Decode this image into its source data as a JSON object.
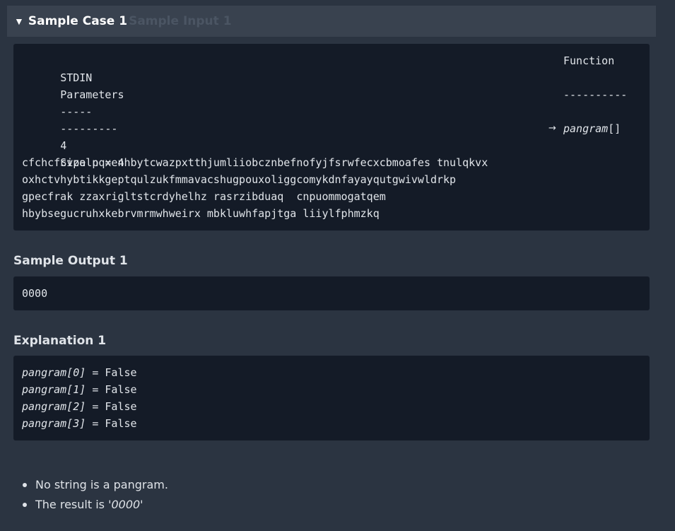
{
  "sample_case": {
    "caret": "▼",
    "title": "Sample Case 1",
    "ghost_title": "Sample Input 1"
  },
  "input_block": {
    "header_left_1": "STDIN",
    "header_right_1": "Function",
    "header_left_2": "Parameters",
    "dash_left_1": "-----",
    "dash_right_1": "----------",
    "dash_left_2": "---------",
    "count": "4",
    "arrow": "→",
    "param_name": "pangram",
    "param_suffix": "[]",
    "size_line": "Size n = 4",
    "lines": [
      "cfchcfcvpalpqxenhbytcwazpxtthjumliiobcznbefnofyjfsrwfecxcbmoafes tnulqkvx",
      "oxhctvhybtikkgeptqulzukfmmavacshugpouxoliggcomykdnfayayqutgwivwldrkp",
      "gpecfrak zzaxrigltstcrdyhelhz rasrzibduaq  cnpuommogatqem",
      "hbybsegucruhxkebrvmrmwhweirx mbkluwhfapjtga liiylfphmzkq"
    ]
  },
  "output": {
    "heading": "Sample Output 1",
    "value": "0000"
  },
  "explanation": {
    "heading": "Explanation 1",
    "rows": [
      {
        "name": "pangram[0]",
        "rest": " = False"
      },
      {
        "name": "pangram[1]",
        "rest": " = False"
      },
      {
        "name": "pangram[2]",
        "rest": " = False"
      },
      {
        "name": "pangram[3]",
        "rest": " = False"
      }
    ],
    "bullets": {
      "b1": "No string is a pangram.",
      "b2_prefix": "The result is ",
      "b2_value": "'0000'"
    }
  }
}
